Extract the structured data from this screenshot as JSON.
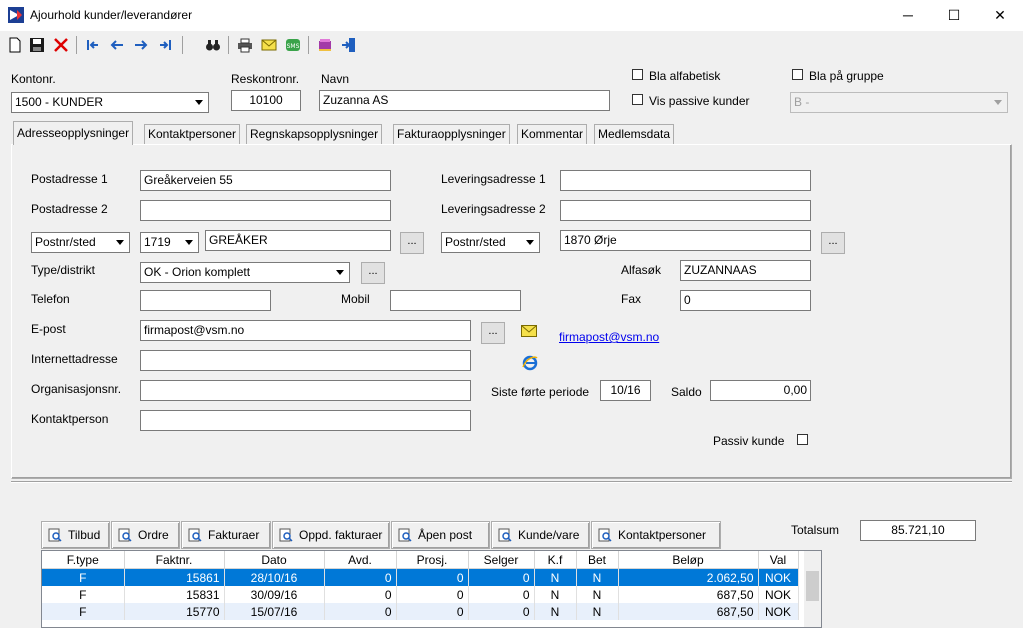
{
  "window": {
    "title": "Ajourhold kunder/leverandører",
    "minimize": "─",
    "maximize": "☐",
    "close": "✕"
  },
  "header": {
    "kontonr_label": "Kontonr.",
    "kontonr_value": "1500 - KUNDER",
    "reskontronr_label": "Reskontronr.",
    "reskontronr_value": "10100",
    "navn_label": "Navn",
    "navn_value": "Zuzanna AS",
    "bla_alfabetisk_label": "Bla alfabetisk",
    "vis_passive_label": "Vis passive kunder",
    "bla_gruppe_label": "Bla på gruppe",
    "gruppe_value": "B  -"
  },
  "tabs": [
    {
      "label": "Adresseopplysninger"
    },
    {
      "label": "Kontaktpersoner"
    },
    {
      "label": "Regnskapsopplysninger"
    },
    {
      "label": "Fakturaopplysninger"
    },
    {
      "label": "Kommentar"
    },
    {
      "label": "Medlemsdata"
    }
  ],
  "form": {
    "postadresse1_label": "Postadresse 1",
    "postadresse1_value": "Greåkerveien 55",
    "postadresse2_label": "Postadresse 2",
    "postadresse2_value": "",
    "postnr_type": "Postnr/sted",
    "postnr_value": "1719",
    "sted_value": "GREÅKER",
    "levering1_label": "Leveringsadresse 1",
    "levering1_value": "",
    "levering2_label": "Leveringsadresse 2",
    "levering2_value": "",
    "lev_postnr_type": "Postnr/sted",
    "lev_sted_value": "1870 Ørje",
    "type_label": "Type/distrikt",
    "type_value": "OK  - Orion komplett",
    "alfasok_label": "Alfasøk",
    "alfasok_value": "ZUZANNAAS",
    "telefon_label": "Telefon",
    "telefon_value": "",
    "mobil_label": "Mobil",
    "mobil_value": "",
    "fax_label": "Fax",
    "fax_value": "0",
    "epost_label": "E-post",
    "epost_value": "firmapost@vsm.no",
    "epost_link": "firmapost@vsm.no",
    "internett_label": "Internettadresse",
    "internett_value": "",
    "orgnr_label": "Organisasjonsnr.",
    "orgnr_value": "",
    "kontakt_label": "Kontaktperson",
    "kontakt_value": "",
    "siste_periode_label": "Siste førte periode",
    "siste_periode_value": "10/16",
    "saldo_label": "Saldo",
    "saldo_value": "0,00",
    "passiv_label": "Passiv kunde",
    "dots": "..."
  },
  "bottom_buttons": [
    {
      "label": "Tilbud"
    },
    {
      "label": "Ordre"
    },
    {
      "label": "Fakturaer"
    },
    {
      "label": "Oppd. fakturaer"
    },
    {
      "label": "Åpen post"
    },
    {
      "label": "Kunde/vare"
    },
    {
      "label": "Kontaktpersoner"
    }
  ],
  "totalsum": {
    "label": "Totalsum",
    "value": "85.721,10"
  },
  "grid": {
    "columns": [
      "F.type",
      "Faktnr.",
      "Dato",
      "Avd.",
      "Prosj.",
      "Selger",
      "K.f",
      "Bet",
      "Beløp",
      "Val"
    ],
    "rows": [
      [
        "F",
        "15861",
        "28/10/16",
        "0",
        "0",
        "0",
        "N",
        "N",
        "2.062,50",
        "NOK"
      ],
      [
        "F",
        "15831",
        "30/09/16",
        "0",
        "0",
        "0",
        "N",
        "N",
        "687,50",
        "NOK"
      ],
      [
        "F",
        "15770",
        "15/07/16",
        "0",
        "0",
        "0",
        "N",
        "N",
        "687,50",
        "NOK"
      ]
    ]
  },
  "colors": {
    "selection": "#0078d7",
    "accent_link": "#0000ee"
  }
}
